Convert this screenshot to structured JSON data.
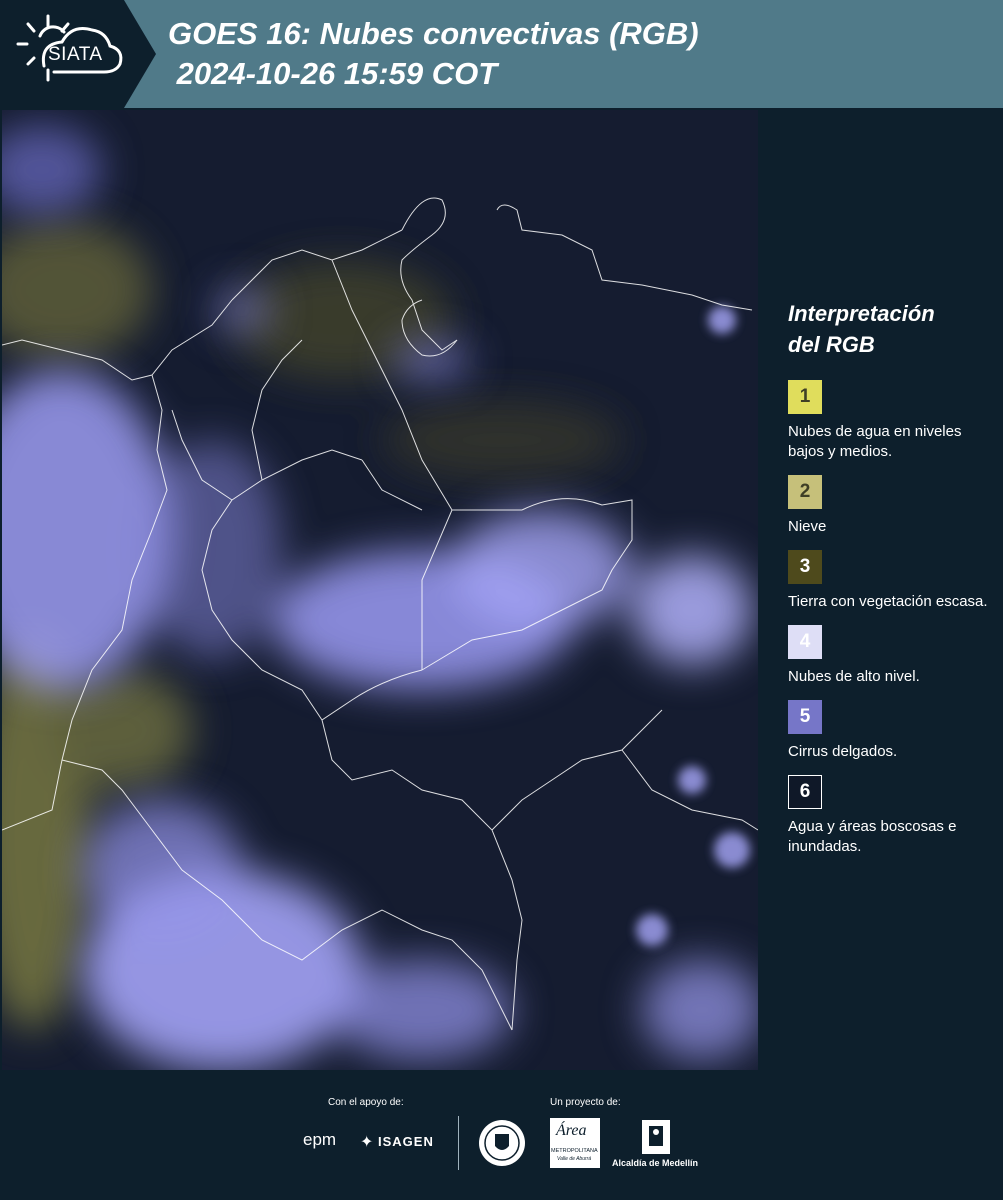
{
  "header": {
    "logo_text": "SIATA",
    "title_line1": "GOES 16: Nubes convectivas (RGB)",
    "title_line2": " 2024-10-26 15:59 COT"
  },
  "legend": {
    "title_line1": "Interpretación",
    "title_line2": "del RGB",
    "items": [
      {
        "num": "1",
        "label": "Nubes de agua en niveles bajos y medios.",
        "color": "#e0dd5c",
        "text_color": "#3f3f26"
      },
      {
        "num": "2",
        "label": "Nieve",
        "color": "#c6c07a",
        "text_color": "#3f3f26"
      },
      {
        "num": "3",
        "label": "Tierra con vegetación escasa.",
        "color": "#4e4a1c",
        "text_color": "#ffffff"
      },
      {
        "num": "4",
        "label": "Nubes de alto nivel.",
        "color": "#dedef6",
        "text_color": "#ffffff"
      },
      {
        "num": "5",
        "label": "Cirrus delgados.",
        "color": "#7676c8",
        "text_color": "#ffffff"
      },
      {
        "num": "6",
        "label": "Agua y áreas boscosas e inundadas.",
        "color": "#0f1828",
        "text_color": "#ffffff"
      }
    ]
  },
  "footer": {
    "support_label": "Con el apoyo de:",
    "project_label": "Un proyecto de:",
    "sponsor_epm": "epm",
    "sponsor_isagen": "ISAGEN",
    "sponsor_metro": "Área",
    "sponsor_metro_sub": "METROPOLITANA",
    "sponsor_metro_sub2": "Valle de Aburrá",
    "sponsor_alcaldia": "Alcaldía de Medellín"
  },
  "colors": {
    "header": "#507a89",
    "background": "#0d1f2c",
    "cloud_high": "#a9a9ff",
    "cloud_low": "#d9d66a"
  }
}
